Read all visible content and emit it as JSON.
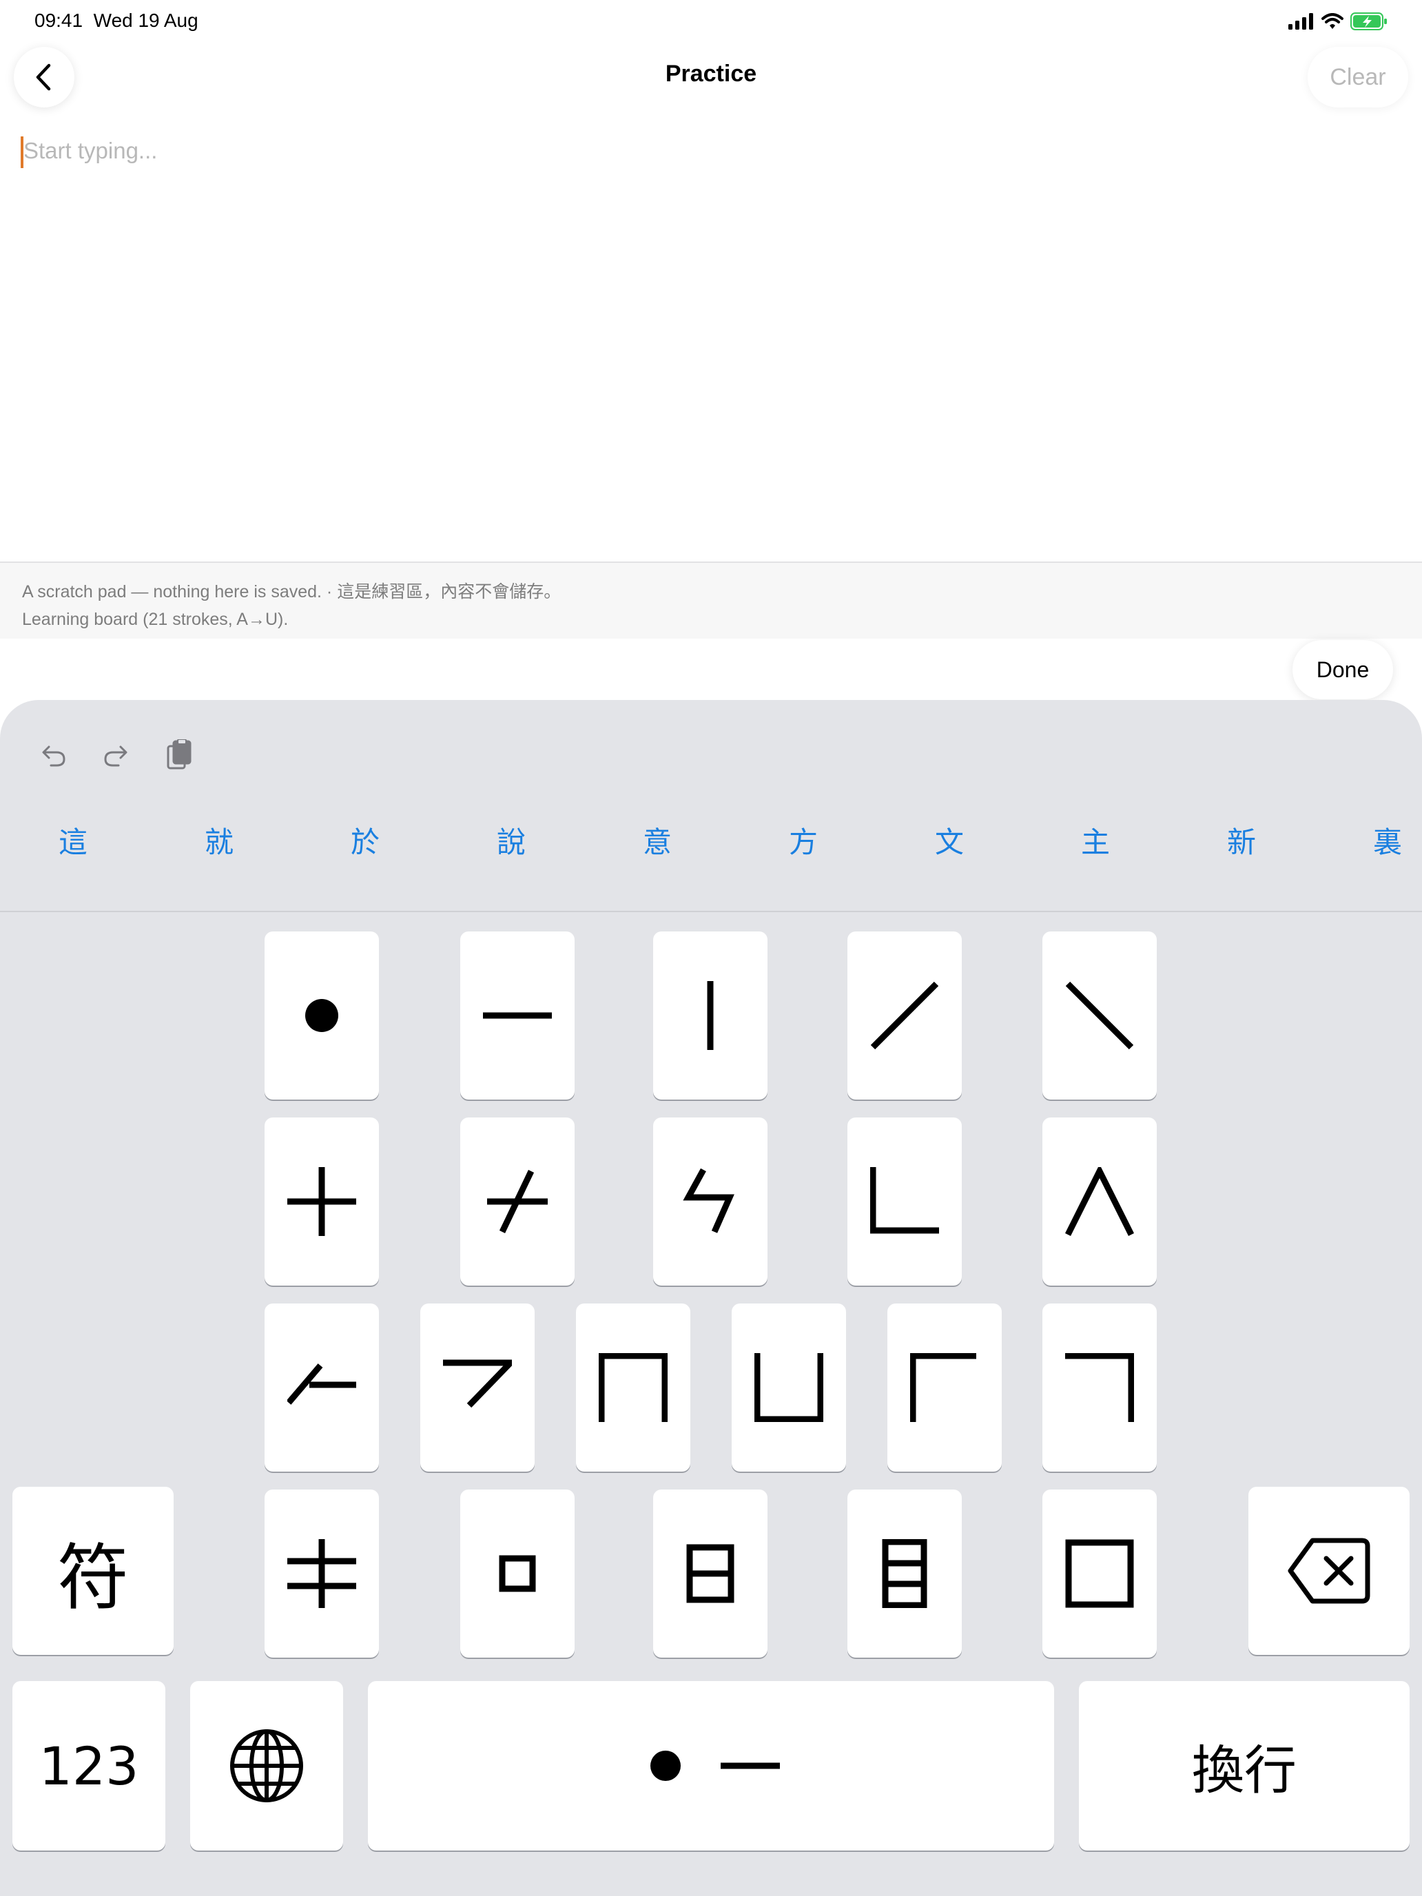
{
  "status": {
    "time": "09:41",
    "date": "Wed 19 Aug"
  },
  "nav": {
    "title": "Practice",
    "clear_label": "Clear"
  },
  "editor": {
    "value": "",
    "placeholder": "Start typing..."
  },
  "info": {
    "line1": "A scratch pad — nothing here is saved. · 這是練習區，內容不會儲存。",
    "line2": "Learning board (21 strokes, A→U)."
  },
  "done_label": "Done",
  "keyboard": {
    "candidates": [
      "這",
      "就",
      "於",
      "說",
      "意",
      "方",
      "文",
      "主",
      "新",
      "裏"
    ],
    "symbols_key": "符",
    "numbers_key": "123",
    "return_key": "換行",
    "stroke_keys": [
      "dot",
      "horizontal",
      "vertical",
      "slash",
      "backslash",
      "cross",
      "slash-cross",
      "zigzag",
      "L-corner",
      "caret",
      "hook-left",
      "seven",
      "arch",
      "cup",
      "gamma",
      "corner-right",
      "double-cross",
      "small-square",
      "sun-box",
      "eye-box",
      "big-square"
    ],
    "space_strokes": [
      "dot",
      "horizontal"
    ]
  },
  "icons": {
    "back": "chevron-left-icon",
    "undo": "undo-icon",
    "redo": "redo-icon",
    "clipboard": "clipboard-icon",
    "globe": "globe-icon",
    "delete": "delete-icon",
    "signal": "signal-icon",
    "wifi": "wifi-icon",
    "battery": "battery-icon"
  },
  "colors": {
    "candidate": "#1a7fe0",
    "caret": "#e07a2a",
    "keyboard_bg": "#e3e4e8",
    "battery": "#35c759"
  }
}
